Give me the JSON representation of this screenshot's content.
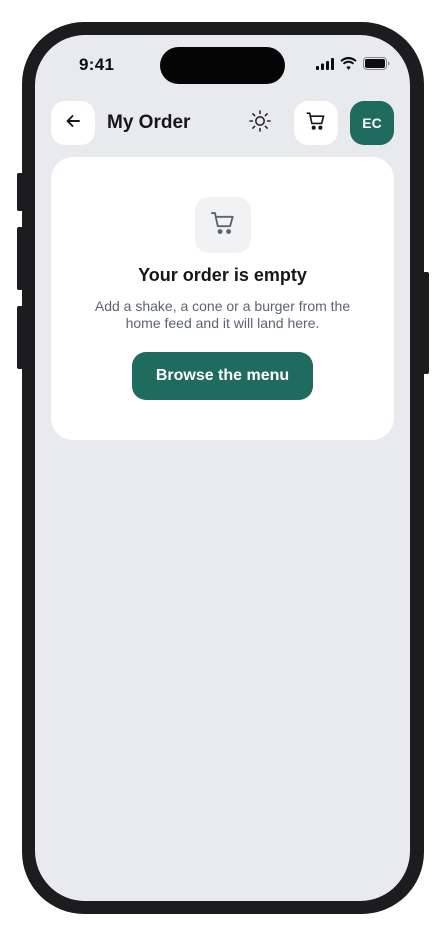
{
  "status_bar": {
    "time": "9:41",
    "signal_icon": "cellular-signal-icon",
    "wifi_icon": "wifi-icon",
    "battery_icon": "battery-icon"
  },
  "header": {
    "back_icon": "arrow-left-icon",
    "title": "My Order",
    "theme_icon": "sun-icon",
    "cart_icon": "shopping-cart-icon",
    "avatar_initials": "EC"
  },
  "empty_state": {
    "icon": "shopping-cart-icon",
    "title": "Your order is empty",
    "description": "Add a shake, a cone or a burger from the home feed and it will land here.",
    "button_label": "Browse the menu"
  },
  "colors": {
    "accent": "#1f6b5e",
    "background": "#e9eaee",
    "card": "#ffffff",
    "text_primary": "#17171a",
    "text_secondary": "#5d6470"
  }
}
